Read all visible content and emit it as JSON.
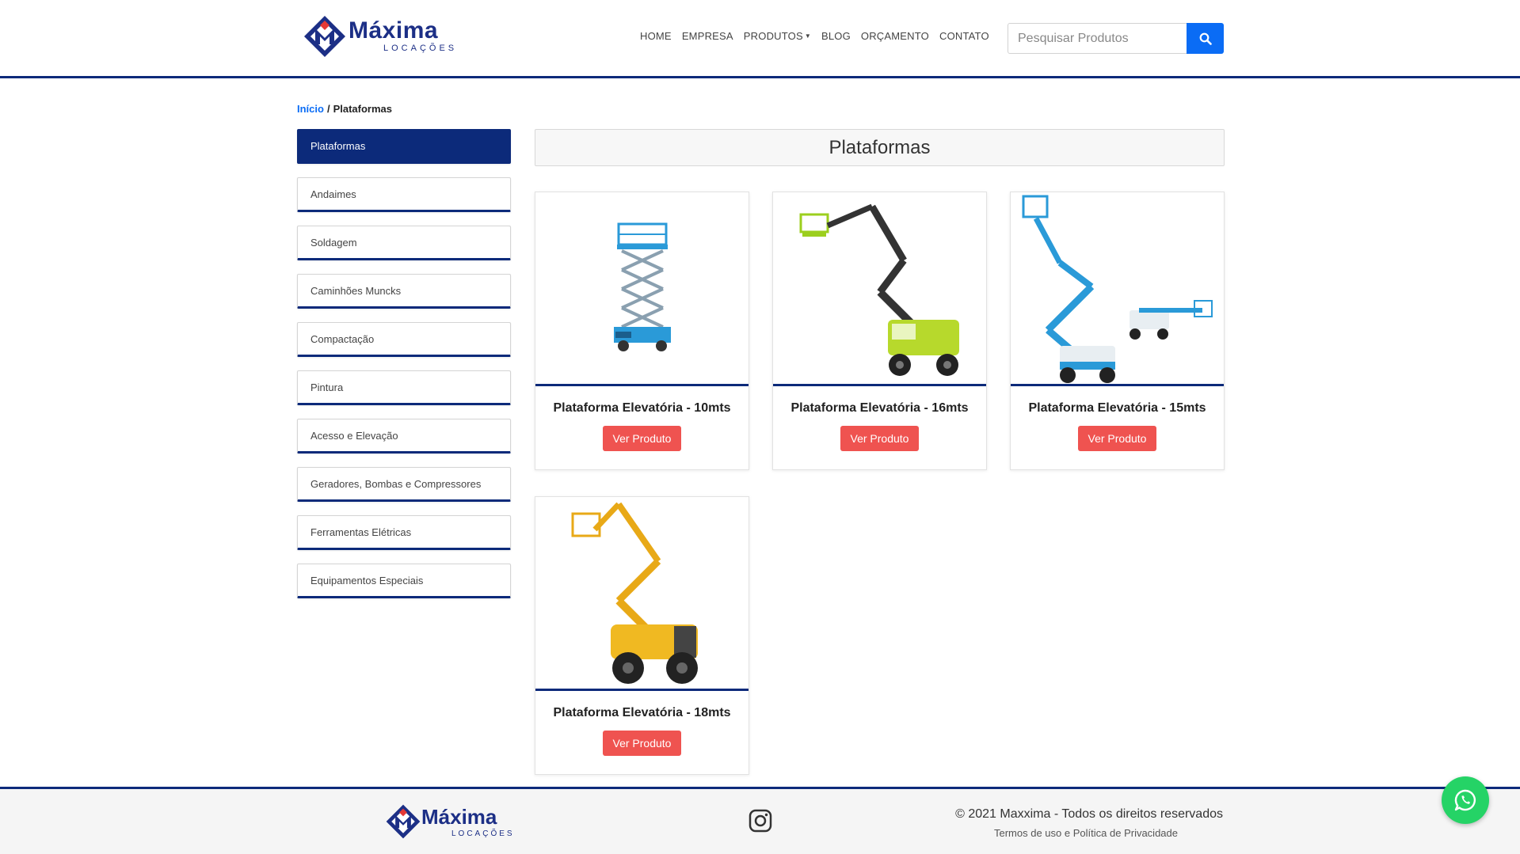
{
  "header": {
    "logo": {
      "brand": "Máxima",
      "sub": "LOCAÇÕES"
    },
    "nav": [
      {
        "label": "HOME"
      },
      {
        "label": "EMPRESA"
      },
      {
        "label": "PRODUTOS"
      },
      {
        "label": "BLOG"
      },
      {
        "label": "ORÇAMENTO"
      },
      {
        "label": "CONTATO"
      }
    ],
    "search": {
      "placeholder": "Pesquisar Produtos",
      "value": "",
      "icon": "search-icon"
    }
  },
  "breadcrumb": {
    "home": "Início",
    "separator": "/",
    "current": "Plataformas"
  },
  "sidebar": {
    "items": [
      {
        "label": "Plataformas",
        "active": true
      },
      {
        "label": "Andaimes"
      },
      {
        "label": "Soldagem"
      },
      {
        "label": "Caminhões Muncks"
      },
      {
        "label": "Compactação"
      },
      {
        "label": "Pintura"
      },
      {
        "label": "Acesso e Elevação"
      },
      {
        "label": "Geradores, Bombas e Compressores"
      },
      {
        "label": "Ferramentas Elétricas"
      },
      {
        "label": "Equipamentos Especiais"
      }
    ]
  },
  "main": {
    "title": "Plataformas",
    "products": [
      {
        "name": "Plataforma Elevatória - 10mts",
        "button": "Ver Produto"
      },
      {
        "name": "Plataforma Elevatória - 16mts",
        "button": "Ver Produto"
      },
      {
        "name": "Plataforma Elevatória - 15mts",
        "button": "Ver Produto"
      },
      {
        "name": "Plataforma Elevatória - 18mts",
        "button": "Ver Produto"
      }
    ]
  },
  "footer": {
    "logo": {
      "brand": "Máxima",
      "sub": "LOCAÇÕES"
    },
    "copyright": "© 2021 Maxxima - Todos os direitos reservados",
    "terms": "Termos de uso",
    "and": "e",
    "privacy": "Política de Privacidade"
  },
  "colors": {
    "primary": "#0c2a7a",
    "accent": "#0a6cf5",
    "button": "#ef5350",
    "whatsapp": "#25d366"
  }
}
